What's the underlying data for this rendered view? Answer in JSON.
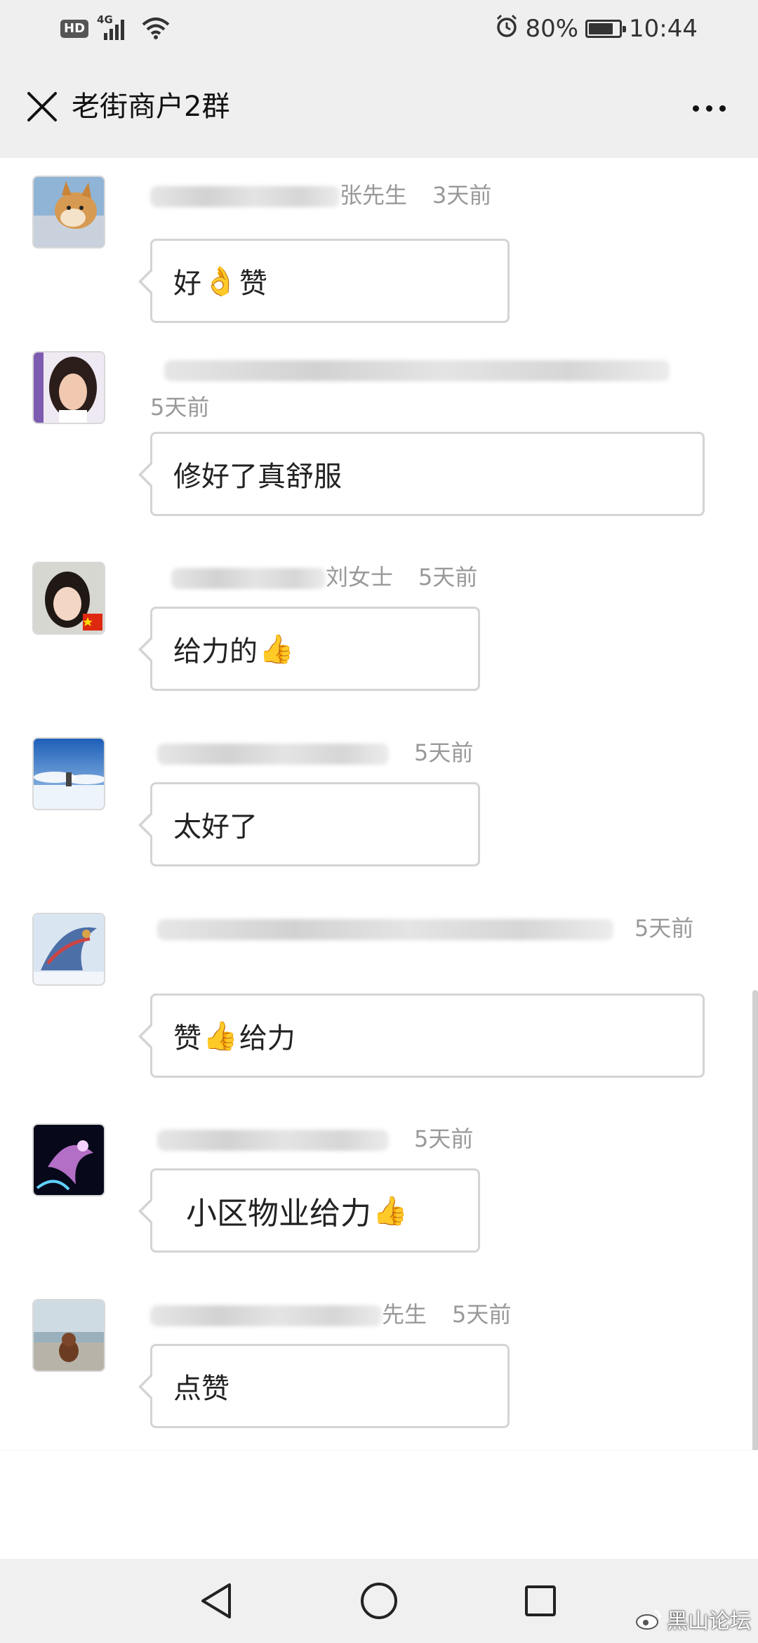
{
  "status_bar": {
    "hd_badge": "HD",
    "network": "4G",
    "battery": "80%",
    "battery_level": 0.8,
    "time": "10:44",
    "icons": [
      "hd-icon",
      "signal-icon",
      "wifi-icon",
      "alarm-icon",
      "battery-icon"
    ]
  },
  "header": {
    "title": "老街商户2群",
    "close_icon": "close-icon",
    "more_icon": "more-icon"
  },
  "messages": [
    {
      "name_suffix": "张先生",
      "time": "3天前",
      "text_before": "好",
      "emoji": "👌",
      "text_after": "赞",
      "avatar": "shiba-dog-avatar"
    },
    {
      "name_suffix": "",
      "time": "5天前",
      "text_before": "修好了真舒服",
      "emoji": "",
      "text_after": "",
      "avatar": "woman-portrait-avatar"
    },
    {
      "name_suffix": "刘女士",
      "time": "5天前",
      "text_before": "给力的",
      "emoji": "👍",
      "text_after": "",
      "avatar": "girl-flag-avatar"
    },
    {
      "name_suffix": "",
      "time": "5天前",
      "text_before": "太好了",
      "emoji": "",
      "text_after": "",
      "avatar": "sky-avatar"
    },
    {
      "name_suffix": "",
      "time": "5天前",
      "text_before": "赞",
      "emoji": "👍",
      "text_after": " 给力",
      "avatar": "dragon-avatar"
    },
    {
      "name_suffix": "",
      "time": "5天前",
      "text_before": "小区物业给力 ",
      "emoji": "👍",
      "text_after": "",
      "avatar": "lantern-avatar"
    },
    {
      "name_suffix": "先生",
      "time": "5天前",
      "text_before": "点赞",
      "emoji": "",
      "text_after": "",
      "avatar": "dog-seaside-avatar"
    }
  ],
  "nav": {
    "icons": [
      "back-icon",
      "home-icon",
      "recents-icon"
    ]
  },
  "watermark": "黑山论坛"
}
